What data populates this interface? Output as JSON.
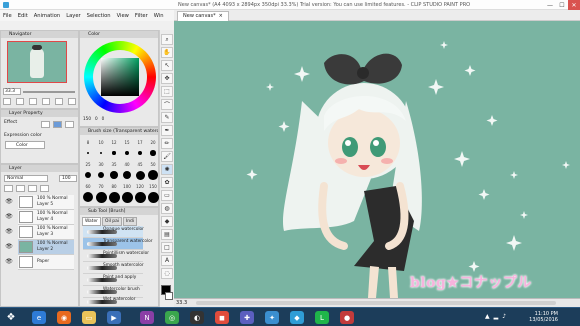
{
  "window": {
    "title": "New canvas* (A4 4093 x 2894px 350dpi 33.3%)  Trial version: You can use limited features. - CLIP STUDIO PAINT PRO",
    "minimize": "—",
    "maximize": "☐",
    "close": "✕"
  },
  "menu": [
    "File",
    "Edit",
    "Animation",
    "Layer",
    "Selection",
    "View",
    "Filter",
    "Win"
  ],
  "canvas_tab": {
    "label": "New canvas*",
    "close": "×"
  },
  "navigator": {
    "title": "Navigator",
    "zoom": "33.3"
  },
  "color": {
    "title": "Color",
    "h": "150",
    "s": "0",
    "v": "0"
  },
  "layer_property": {
    "title": "Layer Property",
    "effect_label": "Effect",
    "expression_label": "Expression color",
    "expression_value": "Color"
  },
  "brush_size": {
    "title": "Brush size (Transparent waterco",
    "sizes": [
      "8",
      "10",
      "12",
      "15",
      "17",
      "20",
      "25",
      "30",
      "35",
      "40",
      "45",
      "50",
      "60",
      "70",
      "80",
      "100",
      "120",
      "150"
    ]
  },
  "layer": {
    "title": "Layer",
    "blend": "Normal",
    "opacity": "100",
    "items": [
      {
        "line1": "100 %  Normal",
        "line2": "Layer 5"
      },
      {
        "line1": "100 %  Normal",
        "line2": "Layer 4"
      },
      {
        "line1": "100 %  Normal",
        "line2": "Layer 3"
      },
      {
        "line1": "100 %  Normal",
        "line2": "Layer 2"
      },
      {
        "line1": "",
        "line2": "Paper"
      }
    ]
  },
  "sub_tool": {
    "title": "Sub Tool [Brush]",
    "tabs": [
      "Water",
      "Oil pai",
      "Indi"
    ],
    "items": [
      "Opaque watercolor",
      "Transparent watercolor",
      "Pointillism watercolor",
      "Smooth watercolor",
      "Paint and apply",
      "Watercolor brush",
      "Wet watercolor"
    ]
  },
  "status": {
    "zoom": "33.3"
  },
  "watermark": "blog★コナップル",
  "clock": {
    "time": "11:10 PM",
    "date": "13/05/2016"
  },
  "colors": {
    "canvas_bg": "#7ab4a2",
    "taskbar": "#1c3d5a"
  }
}
